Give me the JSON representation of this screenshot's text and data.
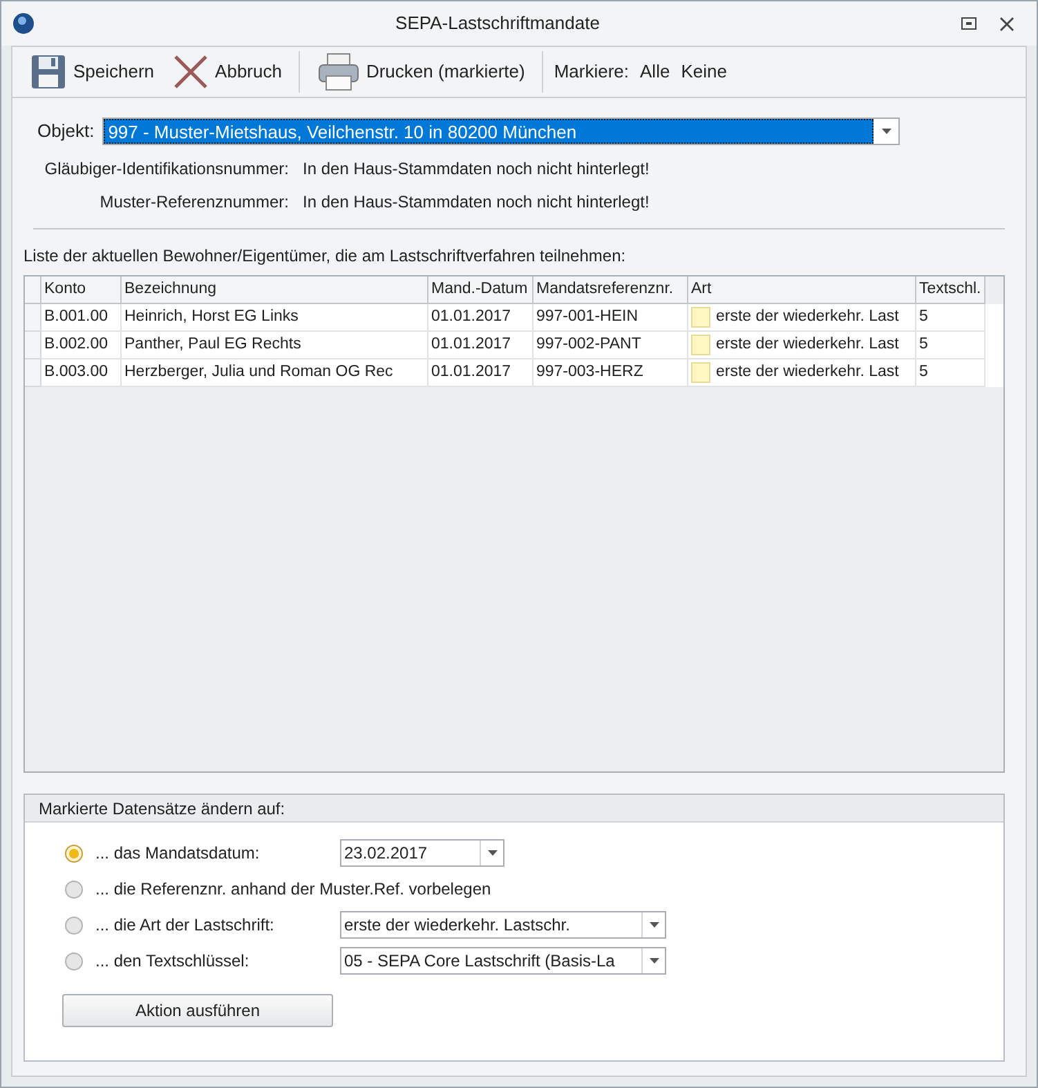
{
  "window": {
    "title": "SEPA-Lastschriftmandate"
  },
  "toolbar": [
    {
      "kind": "save",
      "label": "Speichern"
    },
    {
      "kind": "cancel",
      "label": "Abbruch"
    },
    {
      "kind": "print",
      "label": "Drucken (markierte)"
    }
  ],
  "mark": {
    "label": "Markiere:",
    "links": [
      "Alle",
      "Keine"
    ]
  },
  "objekt": {
    "label": "Objekt:",
    "value": "997 - Muster-Mietshaus, Veilchenstr. 10 in 80200 München"
  },
  "info": [
    {
      "label": "Gläubiger-Identifikationsnummer:",
      "value": "In den Haus-Stammdaten noch nicht hinterlegt!"
    },
    {
      "label": "Muster-Referenznummer:",
      "value": "In den Haus-Stammdaten noch nicht hinterlegt!"
    }
  ],
  "list_caption": "Liste der aktuellen Bewohner/Eigentümer, die am Lastschriftverfahren teilnehmen:",
  "table": {
    "columns": [
      "Konto",
      "Bezeichnung",
      "Mand.-Datum",
      "Mandatsreferenznr.",
      "Art",
      "Textschl."
    ],
    "rows": [
      [
        "B.001.00",
        "Heinrich, Horst EG Links",
        "01.01.2017",
        "997-001-HEIN",
        "erste der wiederkehr. Last",
        "5"
      ],
      [
        "B.002.00",
        "Panther, Paul EG Rechts",
        "01.01.2017",
        "997-002-PANT",
        "erste der wiederkehr. Last",
        "5"
      ],
      [
        "B.003.00",
        "Herzberger, Julia und  Roman OG Rec",
        "01.01.2017",
        "997-003-HERZ",
        "erste der wiederkehr. Last",
        "5"
      ]
    ]
  },
  "group": {
    "title": "Markierte Datensätze ändern auf:",
    "options": [
      {
        "label": "... das Mandatsdatum:",
        "selected": true,
        "value": "23.02.2017"
      },
      {
        "label": "... die Referenznr. anhand der Muster.Ref. vorbelegen",
        "selected": false
      },
      {
        "label": "... die Art der Lastschrift:",
        "selected": false,
        "value": "erste der wiederkehr. Lastschr."
      },
      {
        "label": "... den Textschlüssel:",
        "selected": false,
        "value": "05 - SEPA Core Lastschrift (Basis-La"
      }
    ],
    "button": "Aktion ausführen"
  }
}
